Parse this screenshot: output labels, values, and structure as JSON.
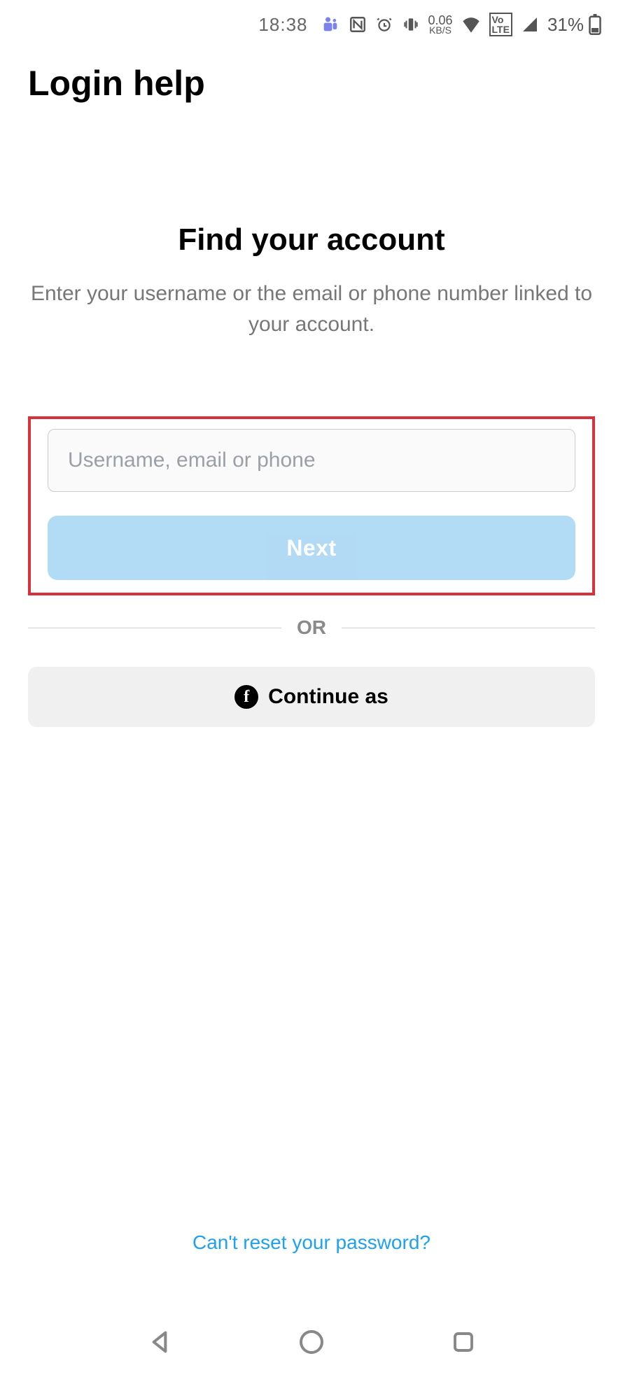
{
  "status": {
    "time": "18:38",
    "net_speed_value": "0.06",
    "net_speed_unit": "KB/S",
    "volte": "Vo\nLTE",
    "battery_pct": "31%"
  },
  "header": {
    "title": "Login help"
  },
  "main": {
    "title": "Find your account",
    "subtitle": "Enter your username or the email or phone number linked to your account.",
    "input_placeholder": "Username, email or phone",
    "input_value": "",
    "next_label": "Next",
    "or_label": "OR",
    "continue_label": "Continue as"
  },
  "footer": {
    "reset_link": "Can't reset your password?"
  }
}
